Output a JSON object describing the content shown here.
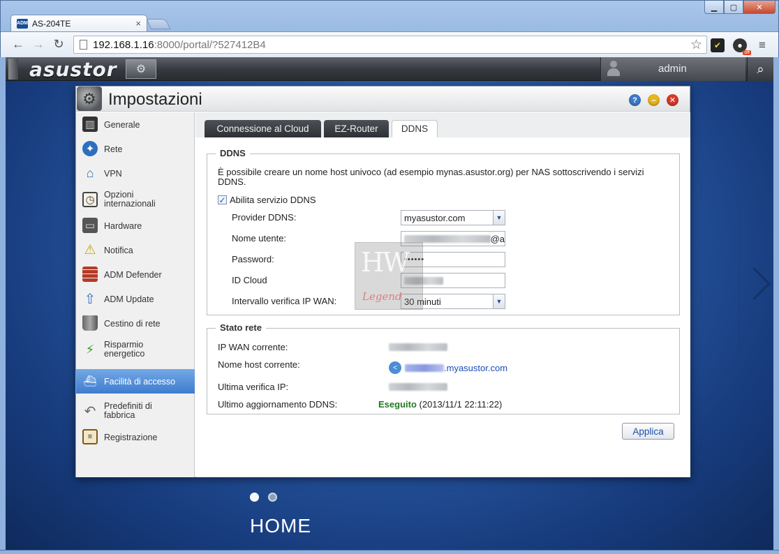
{
  "browser": {
    "tab_title": "AS-204TE",
    "tab_favicon_text": "ADM",
    "url_host": "192.168.1.16",
    "url_path": ":8000/portal/?527412B4",
    "ext_badge": "off"
  },
  "adm": {
    "logo": "asustor",
    "username": "admin",
    "home_label": "HOME"
  },
  "window": {
    "title": "Impostazioni",
    "sidebar": [
      {
        "label": "Generale",
        "icon": "server-icon"
      },
      {
        "label": "Rete",
        "icon": "network-globe-icon"
      },
      {
        "label": "VPN",
        "icon": "vpn-house-icon"
      },
      {
        "label": "Opzioni internazionali",
        "icon": "clock-calendar-icon"
      },
      {
        "label": "Hardware",
        "icon": "hard-drive-icon"
      },
      {
        "label": "Notifica",
        "icon": "warning-icon"
      },
      {
        "label": "ADM Defender",
        "icon": "firewall-icon"
      },
      {
        "label": "ADM Update",
        "icon": "upload-arrow-icon"
      },
      {
        "label": "Cestino di rete",
        "icon": "trash-bin-icon"
      },
      {
        "label": "Risparmio energetico",
        "icon": "power-saving-icon"
      },
      {
        "label": "Facilità di accesso",
        "icon": "access-icon"
      },
      {
        "label": "Predefiniti di fabbrica",
        "icon": "reset-arrow-icon"
      },
      {
        "label": "Registrazione",
        "icon": "clipboard-icon"
      }
    ],
    "active_index": 10,
    "tabs": [
      "Connessione al Cloud",
      "EZ-Router",
      "DDNS"
    ],
    "active_tab": "DDNS",
    "ddns": {
      "legend": "DDNS",
      "description": "È possibile creare un nome host univoco (ad esempio mynas.asustor.org) per NAS sottoscrivendo i servizi DDNS.",
      "enable_label": "Abilita servizio DDNS",
      "enable_checked": true,
      "provider_label": "Provider DDNS:",
      "provider_value": "myasustor.com",
      "username_label": "Nome utente:",
      "username_suffix": "@a",
      "password_label": "Password:",
      "password_value": "••••••",
      "cloud_label": "ID Cloud",
      "interval_label": "Intervallo verifica IP WAN:",
      "interval_value": "30 minuti"
    },
    "status": {
      "legend": "Stato rete",
      "wan_label": "IP WAN corrente:",
      "host_label": "Nome host corrente:",
      "host_value": ".myasustor.com",
      "lastcheck_label": "Ultima verifica IP:",
      "lastupdate_label": "Ultimo aggiornamento DDNS:",
      "lastupdate_status": "Eseguito",
      "lastupdate_time": " (2013/11/1 22:11:22)"
    },
    "apply_label": "Applica"
  },
  "watermark": {
    "line1": "HW",
    "line2": "Legend"
  }
}
